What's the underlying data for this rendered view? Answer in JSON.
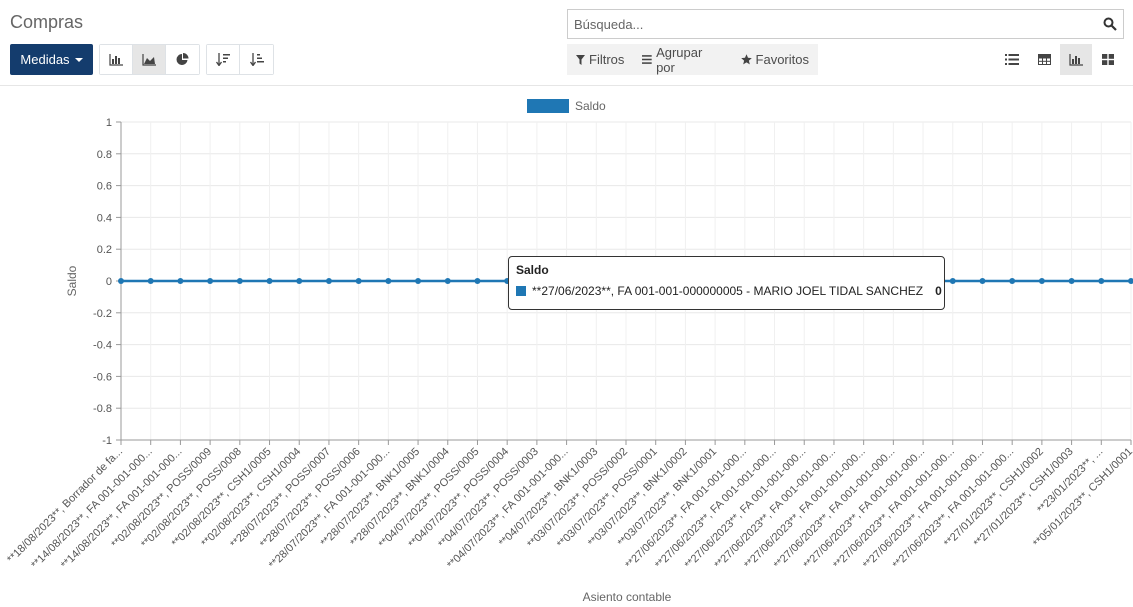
{
  "header": {
    "title": "Compras",
    "search_placeholder": "Búsqueda...",
    "measures_label": "Medidas",
    "filters_label": "Filtros",
    "group_by_label": "Agrupar por",
    "favorites_label": "Favoritos"
  },
  "toolbar": {
    "chart_modes": [
      "bar-chart-icon",
      "area-chart-icon",
      "pie-chart-icon"
    ],
    "active_chart_mode": "area-chart-icon",
    "sort_buttons": [
      "sort-descending-icon",
      "sort-ascending-icon"
    ],
    "views": [
      "list-view-icon",
      "pivot-view-icon",
      "graph-view-icon",
      "kanban-view-icon"
    ],
    "active_view": "graph-view-icon"
  },
  "colors": {
    "primary": "#143C6D",
    "series": "#1f77b4"
  },
  "chart_data": {
    "type": "line",
    "xlabel": "Asiento contable",
    "ylabel": "Saldo",
    "ylim": [
      -1,
      1
    ],
    "yticks": [
      "1",
      "0.8",
      "0.6",
      "0.4",
      "0.2",
      "0",
      "-0.2",
      "-0.4",
      "-0.6",
      "-0.8",
      "-1"
    ],
    "grid": true,
    "legend_position": "top-center",
    "series": [
      {
        "name": "Saldo",
        "values": [
          0,
          0,
          0,
          0,
          0,
          0,
          0,
          0,
          0,
          0,
          0,
          0,
          0,
          0,
          0,
          0,
          0,
          0,
          0,
          0,
          0,
          0,
          0,
          0,
          0,
          0,
          0,
          0,
          0,
          0,
          0,
          0,
          0,
          0,
          0
        ]
      }
    ],
    "categories": [
      "**18/08/2023**, Borrador de fa...",
      "**14/08/2023**, FA 001-001-000...",
      "**14/08/2023**, FA 001-001-000...",
      "**02/08/2023**, POSS/0009",
      "**02/08/2023**, POSS/0008",
      "**02/08/2023**, CSH1/0005",
      "**02/08/2023**, CSH1/0004",
      "**28/07/2023**, POSS/0007",
      "**28/07/2023**, POSS/0006",
      "**28/07/2023**, FA 001-001-000...",
      "**28/07/2023**, BNK1/0005",
      "**28/07/2023**, BNK1/0004",
      "**04/07/2023**, POSS/0005",
      "**04/07/2023**, POSS/0004",
      "**04/07/2023**, POSS/0003",
      "**04/07/2023**, FA 001-001-000...",
      "**04/07/2023**, BNK1/0003",
      "**03/07/2023**, POSS/0002",
      "**03/07/2023**, POSS/0001",
      "**03/07/2023**, BNK1/0002",
      "**03/07/2023**, BNK1/0001",
      "**27/06/2023**, FA 001-001-000...",
      "**27/06/2023**, FA 001-001-000...",
      "**27/06/2023**, FA 001-001-000...",
      "**27/06/2023**, FA 001-001-000...",
      "**27/06/2023**, FA 001-001-000...",
      "**27/06/2023**, FA 001-001-000...",
      "**27/06/2023**, FA 001-001-000...",
      "**27/06/2023**, FA 001-001-000...",
      "**27/06/2023**, FA 001-001-000...",
      "**27/06/2023**, FA 001-001-000...",
      "**27/01/2023**, CSH1/0002",
      "**27/01/2023**, CSH1/0003",
      "**23/01/2023**, ...",
      "**05/01/2023**, CSH1/0001"
    ]
  },
  "tooltip": {
    "title": "Saldo",
    "label": "**27/06/2023**, FA 001-001-000000005 - MARIO JOEL TIDAL SANCHEZ",
    "value": "0"
  }
}
